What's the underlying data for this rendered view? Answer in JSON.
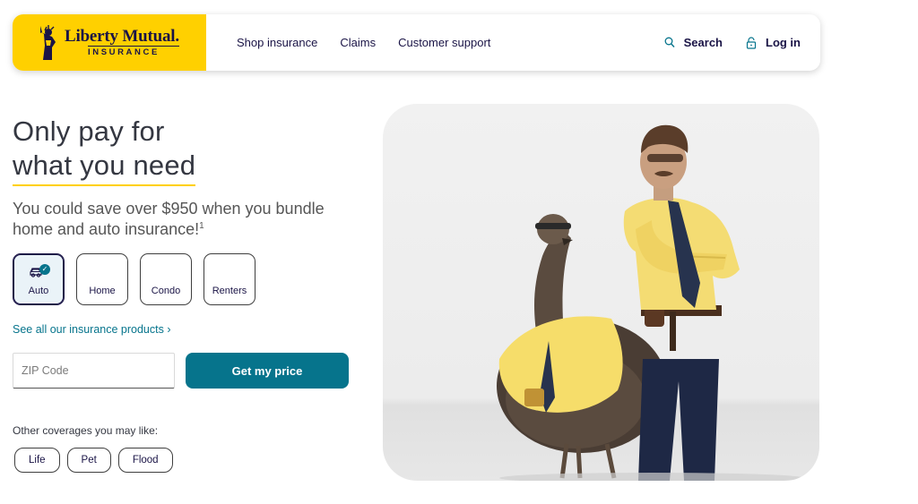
{
  "header": {
    "logo": {
      "name": "Liberty Mutual.",
      "sub": "INSURANCE"
    },
    "nav": [
      "Shop insurance",
      "Claims",
      "Customer support"
    ],
    "search_label": "Search",
    "login_label": "Log in"
  },
  "hero": {
    "headline_line1": "Only pay for",
    "headline_line2": "what you need",
    "subtext": "You could save over $950 when you bundle home and auto insurance!",
    "footnote": "1",
    "products": [
      {
        "label": "Auto",
        "icon": "car-icon",
        "selected": true
      },
      {
        "label": "Home",
        "icon": "home-icon",
        "selected": false
      },
      {
        "label": "Condo",
        "icon": "condo-icon",
        "selected": false
      },
      {
        "label": "Renters",
        "icon": "renters-icon",
        "selected": false
      }
    ],
    "see_all": "See all our insurance products ›",
    "zip_placeholder": "ZIP Code",
    "cta_label": "Get my price",
    "other_label": "Other coverages you may like:",
    "other_coverages": [
      "Life",
      "Pet",
      "Flood"
    ],
    "image": "liberty-man-and-emu-photo"
  },
  "colors": {
    "brand_yellow": "#ffd000",
    "brand_navy": "#1a1446",
    "teal": "#06748c"
  }
}
